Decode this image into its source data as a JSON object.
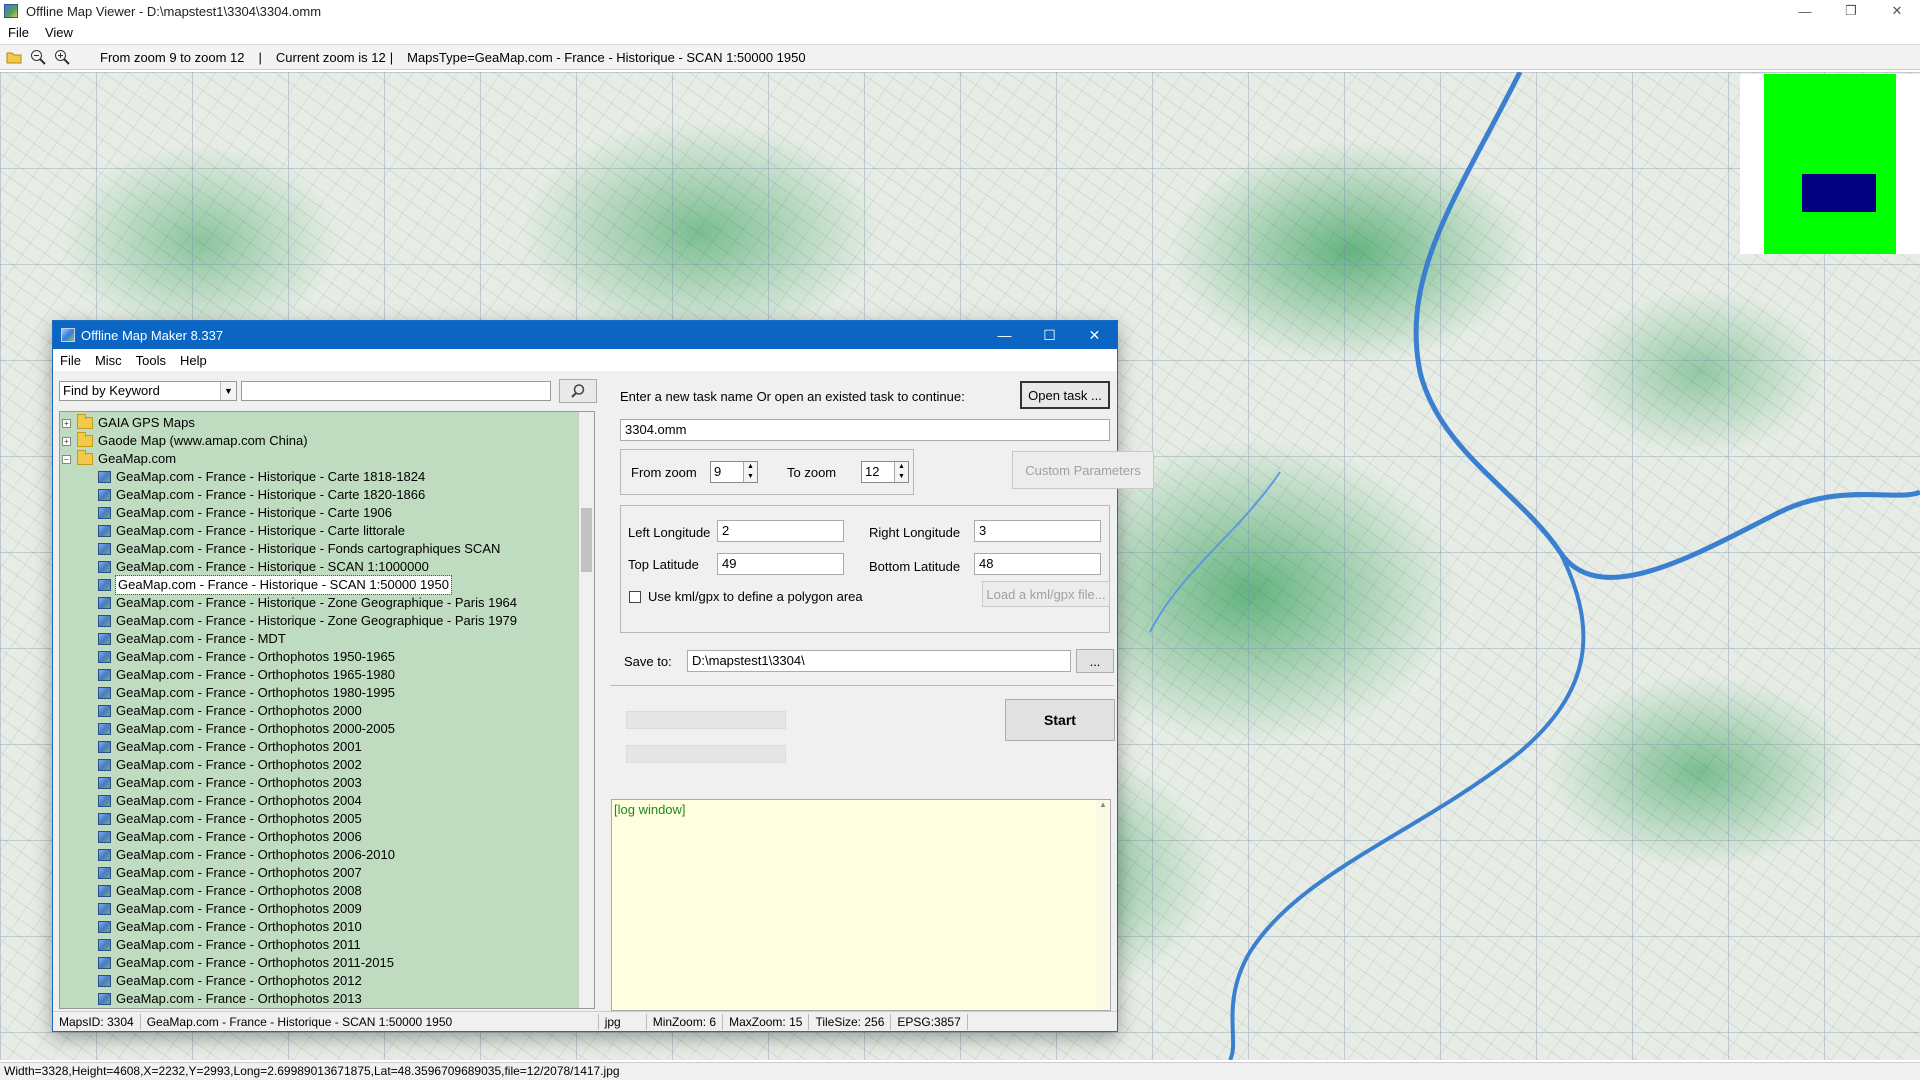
{
  "viewer": {
    "title": "Offline Map Viewer - D:\\mapstest1\\3304\\3304.omm",
    "menu": [
      "File",
      "View"
    ],
    "toolbar": {
      "zoom_range": "From zoom 9 to zoom 12",
      "current_zoom": "Current zoom is 12",
      "maps_type": "MapsType=GeaMap.com - France - Historique - SCAN 1:50000 1950",
      "icons": [
        "open-folder-icon",
        "zoom-out-icon",
        "zoom-in-icon"
      ]
    },
    "status": "Width=3328,Height=4608,X=2232,Y=2993,Long=2.69989013671875,Lat=48.3596709689035,file=12/2078/1417.jpg",
    "window_buttons": [
      "minimize-icon",
      "restore-icon",
      "close-icon"
    ],
    "colors": {
      "minimap_bg": "#00ff00",
      "minimap_box": "#000080"
    }
  },
  "maker": {
    "title": "Offline Map Maker 8.337",
    "menu": [
      "File",
      "Misc",
      "Tools",
      "Help"
    ],
    "search": {
      "mode": "Find by Keyword",
      "query": ""
    },
    "tree": {
      "top": [
        {
          "label": "GAIA GPS Maps",
          "expanded": false
        },
        {
          "label": "Gaode Map (www.amap.com China)",
          "expanded": false
        },
        {
          "label": "GeaMap.com",
          "expanded": true
        }
      ],
      "children": [
        "GeaMap.com - France - Historique - Carte 1818-1824",
        "GeaMap.com - France - Historique - Carte 1820-1866",
        "GeaMap.com - France - Historique - Carte 1906",
        "GeaMap.com - France - Historique - Carte littorale",
        "GeaMap.com - France - Historique - Fonds cartographiques SCAN",
        "GeaMap.com - France - Historique - SCAN 1:1000000",
        "GeaMap.com - France - Historique - SCAN 1:50000 1950",
        "GeaMap.com - France - Historique - Zone Geographique - Paris 1964",
        "GeaMap.com - France - Historique - Zone Geographique - Paris 1979",
        "GeaMap.com - France - MDT",
        "GeaMap.com - France - Orthophotos 1950-1965",
        "GeaMap.com - France - Orthophotos 1965-1980",
        "GeaMap.com - France - Orthophotos 1980-1995",
        "GeaMap.com - France - Orthophotos 2000",
        "GeaMap.com - France - Orthophotos 2000-2005",
        "GeaMap.com - France - Orthophotos 2001",
        "GeaMap.com - France - Orthophotos 2002",
        "GeaMap.com - France - Orthophotos 2003",
        "GeaMap.com - France - Orthophotos 2004",
        "GeaMap.com - France - Orthophotos 2005",
        "GeaMap.com - France - Orthophotos 2006",
        "GeaMap.com - France - Orthophotos 2006-2010",
        "GeaMap.com - France - Orthophotos 2007",
        "GeaMap.com - France - Orthophotos 2008",
        "GeaMap.com - France - Orthophotos 2009",
        "GeaMap.com - France - Orthophotos 2010",
        "GeaMap.com - France - Orthophotos 2011",
        "GeaMap.com - France - Orthophotos 2011-2015",
        "GeaMap.com - France - Orthophotos 2012",
        "GeaMap.com - France - Orthophotos 2013"
      ],
      "selected": "GeaMap.com - France - Historique - SCAN 1:50000 1950"
    },
    "task": {
      "prompt": "Enter a new task name Or open an existed task to continue:",
      "open_button": "Open task ...",
      "name": "3304.omm"
    },
    "zoom": {
      "from_label": "From zoom",
      "from_value": "9",
      "to_label": "To zoom",
      "to_value": "12",
      "custom_button": "Custom Parameters"
    },
    "bounds": {
      "left_label": "Left Longitude",
      "left_value": "2",
      "right_label": "Right Longitude",
      "right_value": "3",
      "top_label": "Top Latitude",
      "top_value": "49",
      "bottom_label": "Bottom Latitude",
      "bottom_value": "48",
      "kml_checkbox_label": "Use kml/gpx to define a polygon area",
      "kml_checked": false,
      "kml_button": "Load a kml/gpx file..."
    },
    "save": {
      "label": "Save to:",
      "path": "D:\\mapstest1\\3304\\",
      "browse": "..."
    },
    "start_button": "Start",
    "progress": [
      0,
      0
    ],
    "log": "[log window]",
    "status": {
      "maps_id": "MapsID: 3304",
      "map_name": "GeaMap.com - France - Historique - SCAN 1:50000 1950",
      "format": "jpg",
      "min_zoom": "MinZoom: 6",
      "max_zoom": "MaxZoom: 15",
      "tile_size": "TileSize: 256",
      "epsg": "EPSG:3857"
    }
  }
}
